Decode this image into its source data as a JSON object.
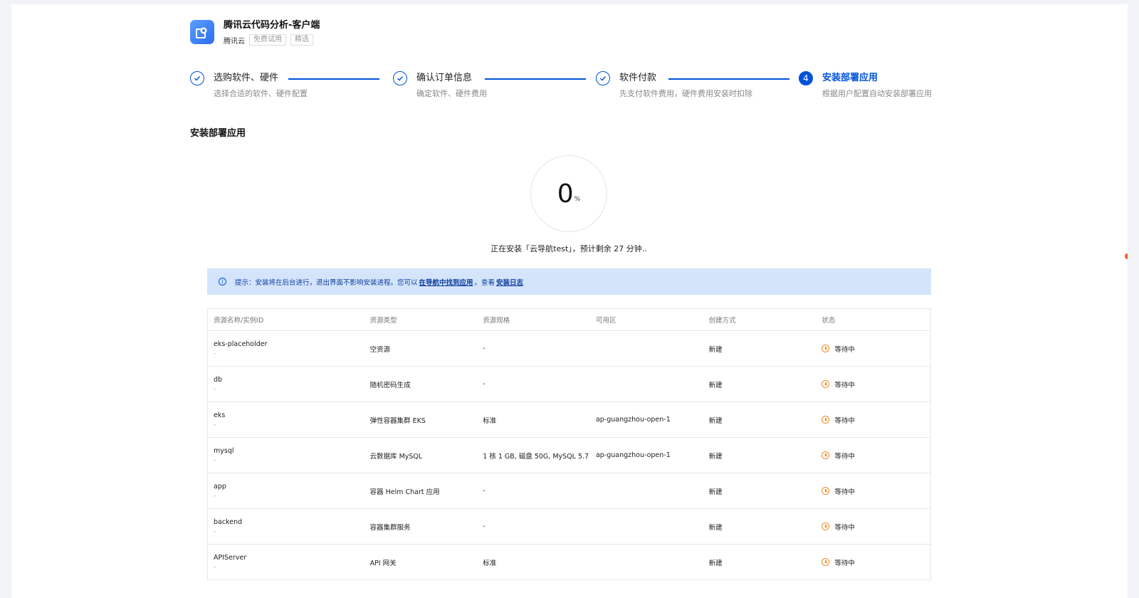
{
  "product": {
    "title": "腾讯云代码分析-客户端",
    "vendor": "腾讯云",
    "tags": [
      "免费试用",
      "精选"
    ]
  },
  "steps": [
    {
      "title": "选购软件、硬件",
      "desc": "选择合适的软件、硬件配置",
      "state": "done"
    },
    {
      "title": "确认订单信息",
      "desc": "确定软件、硬件费用",
      "state": "done"
    },
    {
      "title": "软件付款",
      "desc": "先支付软件费用，硬件费用安装时扣除",
      "state": "done"
    },
    {
      "title": "安装部署应用",
      "desc": "根据用户配置自动安装部署应用",
      "state": "active",
      "number": "4"
    }
  ],
  "section_title": "安装部署应用",
  "progress": {
    "value": "0",
    "unit": "%",
    "text": "正在安装「云导航test」，预计剩余 27 分钟.."
  },
  "alert": {
    "prefix": "提示：安装将在后台进行，退出界面不影响安装进程。您可以",
    "link1": "在导航中找到应用",
    "middle": "。查看",
    "link2": "安装日志"
  },
  "table": {
    "headers": [
      "资源名称/实例ID",
      "资源类型",
      "资源规格",
      "可用区",
      "创建方式",
      "状态"
    ],
    "rows": [
      {
        "name": "eks-placeholder",
        "id": "-",
        "type": "空资源",
        "spec": "-",
        "zone": "",
        "method": "新建",
        "status": "等待中"
      },
      {
        "name": "db",
        "id": "-",
        "type": "随机密码生成",
        "spec": "-",
        "zone": "",
        "method": "新建",
        "status": "等待中"
      },
      {
        "name": "eks",
        "id": "-",
        "type": "弹性容器集群 EKS",
        "spec": "标准",
        "zone": "ap-guangzhou-open-1",
        "method": "新建",
        "status": "等待中"
      },
      {
        "name": "mysql",
        "id": "-",
        "type": "云数据库 MySQL",
        "spec": "1 核 1 GB, 磁盘 50G, MySQL 5.7",
        "zone": "ap-guangzhou-open-1",
        "method": "新建",
        "status": "等待中"
      },
      {
        "name": "app",
        "id": "-",
        "type": "容器 Helm Chart 应用",
        "spec": "-",
        "zone": "",
        "method": "新建",
        "status": "等待中"
      },
      {
        "name": "backend",
        "id": "-",
        "type": "容器集群服务",
        "spec": "-",
        "zone": "",
        "method": "新建",
        "status": "等待中"
      },
      {
        "name": "APIServer",
        "id": "-",
        "type": "API 网关",
        "spec": "标准",
        "zone": "",
        "method": "新建",
        "status": "等待中"
      }
    ]
  },
  "colors": {
    "primary": "#0052d9",
    "warning": "#f08a24",
    "alert_bg": "#d4e4fb"
  }
}
